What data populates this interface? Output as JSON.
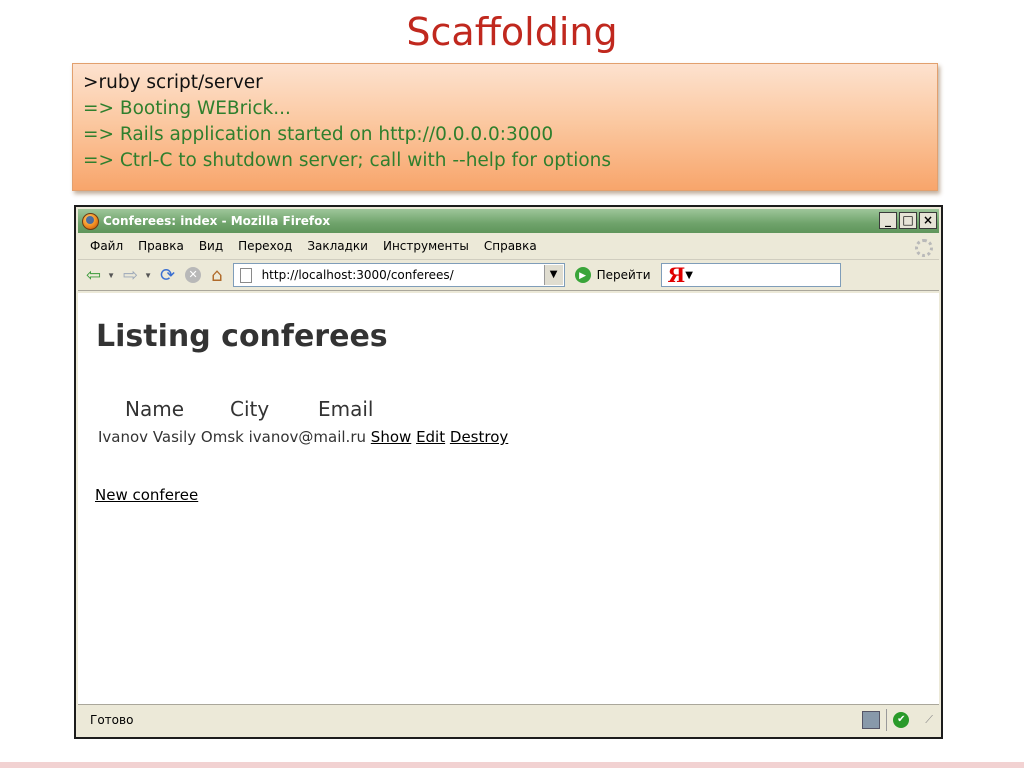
{
  "slide": {
    "title": "Scaffolding",
    "console": {
      "command": ">ruby script/server",
      "lines": [
        "=> Booting WEBrick...",
        "=> Rails application started on http://0.0.0.0:3000",
        "=> Ctrl-C to shutdown server; call with --help for options"
      ]
    }
  },
  "browser": {
    "window_title": "Conferees: index - Mozilla Firefox",
    "window_buttons": [
      "_",
      "□",
      "×"
    ],
    "menu": [
      "Файл",
      "Правка",
      "Вид",
      "Переход",
      "Закладки",
      "Инструменты",
      "Справка"
    ],
    "address_bar": {
      "url": "http://localhost:3000/conferees/"
    },
    "go_label": "Перейти",
    "search_logo": "Я",
    "status_text": "Готово",
    "icons": {
      "app": "firefox-icon",
      "back": "back-arrow-icon",
      "forward": "forward-arrow-icon",
      "reload": "reload-icon",
      "stop": "stop-icon",
      "home": "home-icon",
      "page": "page-icon",
      "go": "go-icon",
      "throbber": "throbber-icon"
    }
  },
  "page": {
    "heading": "Listing conferees",
    "columns": [
      "Name",
      "City",
      "Email"
    ],
    "rows": [
      {
        "name": "Ivanov Vasily",
        "city": "Omsk",
        "email": "ivanov@mail.ru",
        "actions": [
          "Show",
          "Edit",
          "Destroy"
        ]
      }
    ],
    "new_link": "New conferee"
  },
  "colors": {
    "title": "#c0281e",
    "console_output": "#2f7f2d",
    "titlebar": "#6fa36b"
  }
}
